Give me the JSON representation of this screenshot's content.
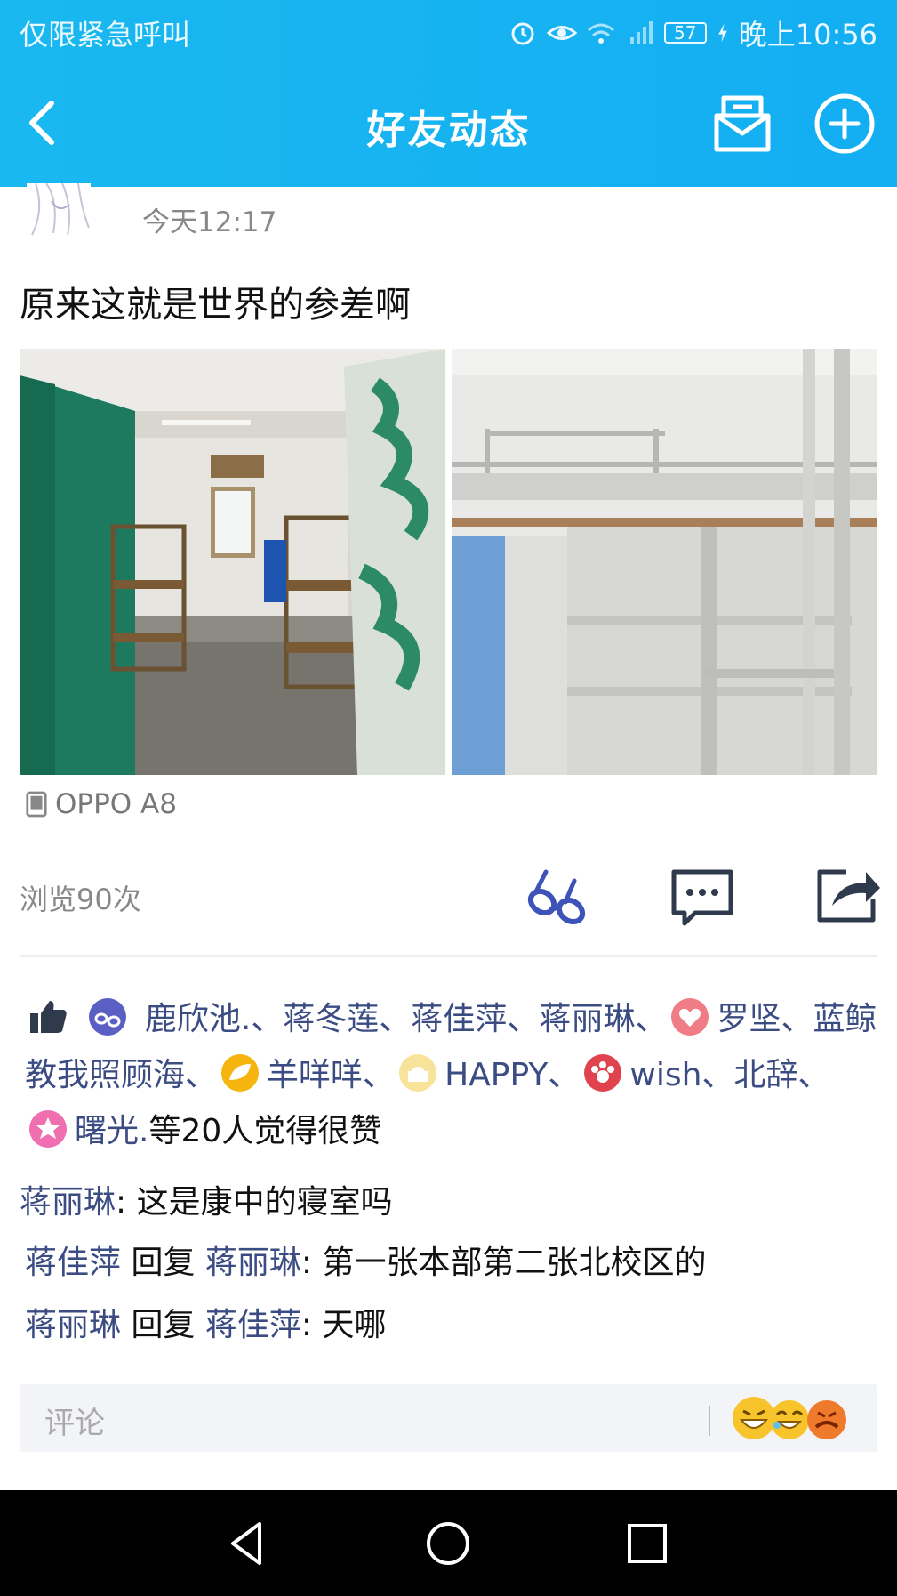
{
  "status_bar": {
    "carrier_text": "仅限紧急呼叫",
    "battery": "57",
    "time": "晚上10:56"
  },
  "title_bar": {
    "title": "好友动态"
  },
  "post": {
    "time": "今天12:17",
    "text": "原来这就是世界的参差啊",
    "device": "OPPO A8",
    "views": "浏览90次"
  },
  "likes": {
    "names": [
      "鹿欣池.",
      "蒋冬莲",
      "蒋佳萍",
      "蒋丽琳",
      "罗坚",
      "蓝鲸教我照顾海",
      "羊咩咩",
      "HAPPY",
      "wish",
      "北辞",
      "曙光."
    ],
    "separator": "、",
    "summary": "等20人觉得很赞"
  },
  "comments": [
    {
      "author": "蒋丽琳",
      "reply_word": "",
      "reply_to": "",
      "text": ": 这是康中的寝室吗"
    },
    {
      "author": "蒋佳萍",
      "reply_word": " 回复 ",
      "reply_to": "蒋丽琳",
      "text": ": 第一张本部第二张北校区的"
    },
    {
      "author": "蒋丽琳",
      "reply_word": " 回复 ",
      "reply_to": "蒋佳萍",
      "text": ": 天哪"
    }
  ],
  "comment_bar": {
    "placeholder": "评论"
  },
  "colors": {
    "header": "#14aef2",
    "link_name": "#3b4c83",
    "icon_dark": "#2f3b4d"
  }
}
